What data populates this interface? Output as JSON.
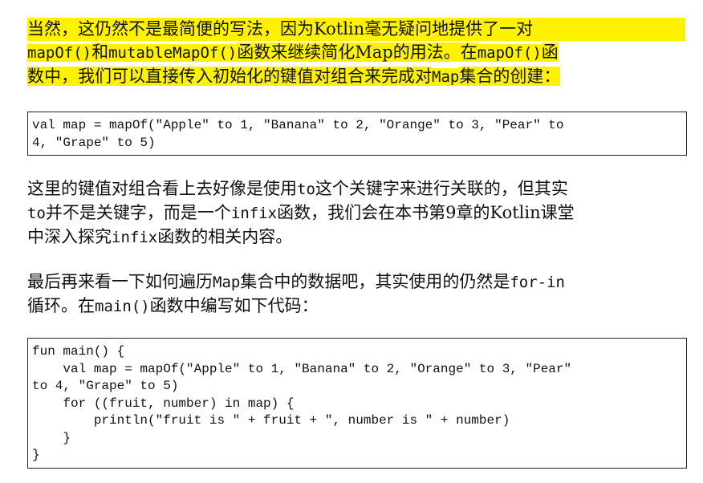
{
  "para1": {
    "line1": [
      {
        "t": "当然，这仍然不是最简便的写法，因为Kotlin毫无疑问地提供了一对",
        "m": false
      }
    ],
    "line2": [
      {
        "t": "mapOf()",
        "m": true
      },
      {
        "t": "和",
        "m": false
      },
      {
        "t": "mutableMapOf()",
        "m": true
      },
      {
        "t": "函数来继续简化Map的用法。在",
        "m": false
      },
      {
        "t": "mapOf()",
        "m": true
      },
      {
        "t": "函",
        "m": false
      }
    ],
    "line3": [
      {
        "t": "数中，我们可以直接传入初始化的键值对组合来完成对",
        "m": false
      },
      {
        "t": "Map",
        "m": true
      },
      {
        "t": "集合的创建：",
        "m": false
      }
    ]
  },
  "code1": [
    "val map = mapOf(\"Apple\" to 1, \"Banana\" to 2, \"Orange\" to 3, \"Pear\" to",
    "4, \"Grape\" to 5)"
  ],
  "para2": {
    "line1": [
      {
        "t": "这里的键值对组合看上去好像是使用",
        "m": false
      },
      {
        "t": "to",
        "m": true
      },
      {
        "t": "这个关键字来进行关联的，但其实",
        "m": false
      }
    ],
    "line2": [
      {
        "t": "to",
        "m": true
      },
      {
        "t": "并不是关键字，而是一个",
        "m": false
      },
      {
        "t": "infix",
        "m": true
      },
      {
        "t": "函数，我们会在本书第9章的Kotlin课堂",
        "m": false
      }
    ],
    "line3": [
      {
        "t": "中深入探究",
        "m": false
      },
      {
        "t": "infix",
        "m": true
      },
      {
        "t": "函数的相关内容。",
        "m": false
      }
    ]
  },
  "para3": {
    "line1": [
      {
        "t": "最后再来看一下如何遍历",
        "m": false
      },
      {
        "t": "Map",
        "m": true
      },
      {
        "t": "集合中的数据吧，其实使用的仍然是",
        "m": false
      },
      {
        "t": "for-in",
        "m": true
      }
    ],
    "line2": [
      {
        "t": "循环。在",
        "m": false
      },
      {
        "t": "main()",
        "m": true
      },
      {
        "t": "函数中编写如下代码：",
        "m": false
      }
    ]
  },
  "code2": [
    "fun main() {",
    "    val map = mapOf(\"Apple\" to 1, \"Banana\" to 2, \"Orange\" to 3, \"Pear\"",
    "to 4, \"Grape\" to 5)",
    "    for ((fruit, number) in map) {",
    "        println(\"fruit is \" + fruit + \", number is \" + number)",
    "    }",
    "}"
  ],
  "colors": {
    "highlight": "#fff200",
    "text": "#111111",
    "border": "#222222"
  }
}
